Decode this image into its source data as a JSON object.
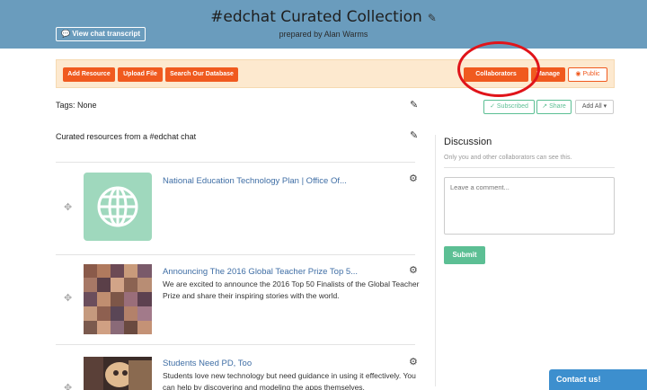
{
  "header": {
    "title": "#edchat Curated Collection",
    "subtitle": "prepared by Alan Warms",
    "transcript_button": "View chat transcript"
  },
  "toolbar": {
    "add_resource": "Add Resource",
    "upload_file": "Upload File",
    "search_database": "Search Our Database",
    "collaborators": "Collaborators",
    "manage": "Manage",
    "public": "Public"
  },
  "tags": {
    "text": "Tags:  None"
  },
  "actions": {
    "subscribed": "Subscribed",
    "share": "Share",
    "add_all": "Add All"
  },
  "description": "Curated resources from a #edchat chat",
  "resources": [
    {
      "title": "National Education Technology Plan | Office Of...",
      "body": ""
    },
    {
      "title": "Announcing The 2016 Global Teacher Prize Top 5...",
      "body": "We are excited to announce the 2016 Top 50 Finalists of the Global Teacher Prize and share their inspiring stories with the world."
    },
    {
      "title": "Students Need PD, Too",
      "body": "Students love new technology but need guidance in using it effectively. You can help by discovering and modeling the apps themselves."
    }
  ],
  "discussion": {
    "title": "Discussion",
    "subtitle": "Only you and other collaborators can see this.",
    "placeholder": "Leave a comment...",
    "submit": "Submit"
  },
  "contact": "Contact us!",
  "colors": {
    "header": "#6a9cbd",
    "toolbar_bg": "#fde9cf",
    "orange": "#f05a1f",
    "submit": "#5cbf94",
    "link": "#3f6ea5",
    "annotation": "#e0141a"
  }
}
